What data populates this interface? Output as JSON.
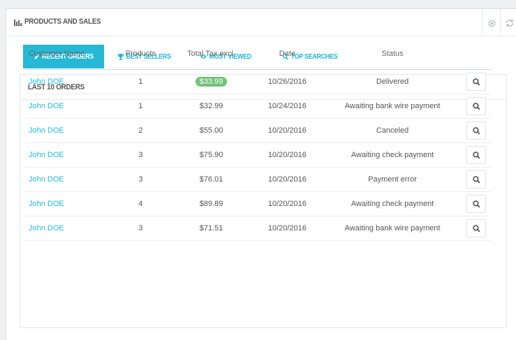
{
  "panel": {
    "title": "PRODUCTS AND SALES",
    "icons": [
      "bar-chart-icon",
      "gear-icon",
      "refresh-icon"
    ]
  },
  "tabs": [
    {
      "label": "RECENT ORDERS",
      "icon": "pencil-icon",
      "active": true
    },
    {
      "label": "BEST SELLERS",
      "icon": "trophy-icon",
      "active": false
    },
    {
      "label": "MOST VIEWED",
      "icon": "eye-icon",
      "active": false
    },
    {
      "label": "TOP SEARCHES",
      "icon": "search-icon",
      "active": false
    }
  ],
  "orders": {
    "title": "LAST 10 ORDERS",
    "columns": [
      "Customer Name",
      "Products",
      "Total Tax excl.",
      "Date",
      "Status"
    ],
    "rows": [
      {
        "customer": "John DOE",
        "products": "1",
        "total": "$33.99",
        "date": "10/26/2016",
        "status": "Delivered"
      },
      {
        "customer": "John DOE",
        "products": "1",
        "total": "$32.99",
        "date": "10/24/2016",
        "status": "Awaiting bank wire payment"
      },
      {
        "customer": "John DOE",
        "products": "2",
        "total": "$55.00",
        "date": "10/20/2016",
        "status": "Canceled"
      },
      {
        "customer": "John DOE",
        "products": "3",
        "total": "$75.90",
        "date": "10/20/2016",
        "status": "Awaiting check payment"
      },
      {
        "customer": "John DOE",
        "products": "3",
        "total": "$76.01",
        "date": "10/20/2016",
        "status": "Payment error"
      },
      {
        "customer": "John DOE",
        "products": "4",
        "total": "$89.89",
        "date": "10/20/2016",
        "status": "Awaiting check payment"
      },
      {
        "customer": "John DOE",
        "products": "3",
        "total": "$71.51",
        "date": "10/20/2016",
        "status": "Awaiting bank wire payment"
      }
    ]
  },
  "colors": {
    "accent": "#25b9d7",
    "badge": "#72c279"
  }
}
